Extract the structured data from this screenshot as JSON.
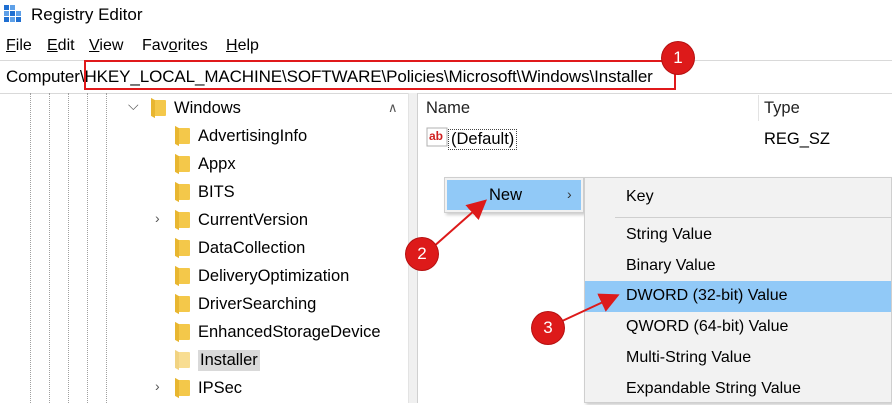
{
  "window": {
    "title": "Registry Editor"
  },
  "menubar": {
    "items": [
      {
        "underline": "F",
        "rest": "ile"
      },
      {
        "underline": "E",
        "rest": "dit"
      },
      {
        "underline": "V",
        "rest": "iew"
      },
      {
        "underline": "",
        "rest": "Fav",
        "underline2": "o",
        "rest2": "rites"
      },
      {
        "underline": "H",
        "rest": "elp"
      }
    ]
  },
  "address": {
    "path": "Computer\\HKEY_LOCAL_MACHINE\\SOFTWARE\\Policies\\Microsoft\\Windows\\Installer"
  },
  "tree": {
    "parent": "Windows",
    "children": [
      "AdvertisingInfo",
      "Appx",
      "BITS",
      "CurrentVersion",
      "DataCollection",
      "DeliveryOptimization",
      "DriverSearching",
      "EnhancedStorageDevice",
      "Installer",
      "IPSec"
    ]
  },
  "values_list": {
    "headers": {
      "name": "Name",
      "type": "Type"
    },
    "rows": [
      {
        "name": "(Default)",
        "type": "REG_SZ"
      }
    ]
  },
  "context_menu": {
    "new_label": "New",
    "submenu": [
      "Key",
      "String Value",
      "Binary Value",
      "DWORD (32-bit) Value",
      "QWORD (64-bit) Value",
      "Multi-String Value",
      "Expandable String Value"
    ]
  },
  "annotations": {
    "badges": [
      "1",
      "2",
      "3"
    ]
  },
  "colors": {
    "highlight": "#91c9f7",
    "annotation_red": "#dd1a1a",
    "folder": "#f4c84a"
  }
}
